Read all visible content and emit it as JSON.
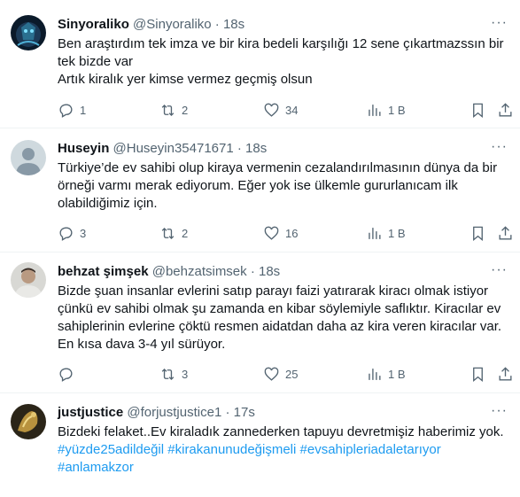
{
  "tweets": [
    {
      "name": "Sinyoraliko",
      "handle": "@Sinyoraliko",
      "time": "18s",
      "lines": [
        "Ben araştırdım tek imza ve bir kira bedeli karşılığı 12 sene çıkartmazssın bir tek bizde var",
        "Artık kiralık yer kimse vermez geçmiş olsun"
      ],
      "replies": "1",
      "reposts": "2",
      "likes": "34",
      "views": "1 B"
    },
    {
      "name": "Huseyin",
      "handle": "@Huseyin35471671",
      "time": "18s",
      "lines": [
        "Türkiye’de ev sahibi olup kiraya vermenin cezalandırılmasının dünya da bir örneği varmı merak ediyorum. Eğer yok ise ülkemle gururlanıcam ilk olabildiğimiz için."
      ],
      "replies": "3",
      "reposts": "2",
      "likes": "16",
      "views": "1 B"
    },
    {
      "name": "behzat şimşek",
      "handle": "@behzatsimsek",
      "time": "18s",
      "lines": [
        "Bizde şuan insanlar evlerini satıp parayı faizi yatırarak kiracı olmak istiyor çünkü ev sahibi olmak şu zamanda en kibar söylemiyle saflıktır. Kiracılar ev sahiplerinin evlerine çöktü resmen aidatdan daha az kira veren kiracılar var. En kısa dava 3-4 yıl sürüyor."
      ],
      "replies": "",
      "reposts": "3",
      "likes": "25",
      "views": "1 B"
    },
    {
      "name": "justjustice",
      "handle": "@forjustjustice1",
      "time": "17s",
      "lines": [
        "Bizdeki felaket..Ev kiraladık zannederken tapuyu devretmişiz haberimiz yok."
      ],
      "hashtags": "#yüzde25adildeğil #kirakanunudeğişmeli #evsahipleriadaletarıyor #anlamakzor"
    }
  ],
  "colors": {
    "text": "#0f1419",
    "muted": "#536471",
    "link": "#1d9bf0",
    "divider": "#eff3f4"
  },
  "icons": [
    "reply-icon",
    "repost-icon",
    "like-icon",
    "views-icon",
    "bookmark-icon",
    "share-icon",
    "more-icon"
  ],
  "ui": {
    "dot": "·",
    "more": "···"
  }
}
